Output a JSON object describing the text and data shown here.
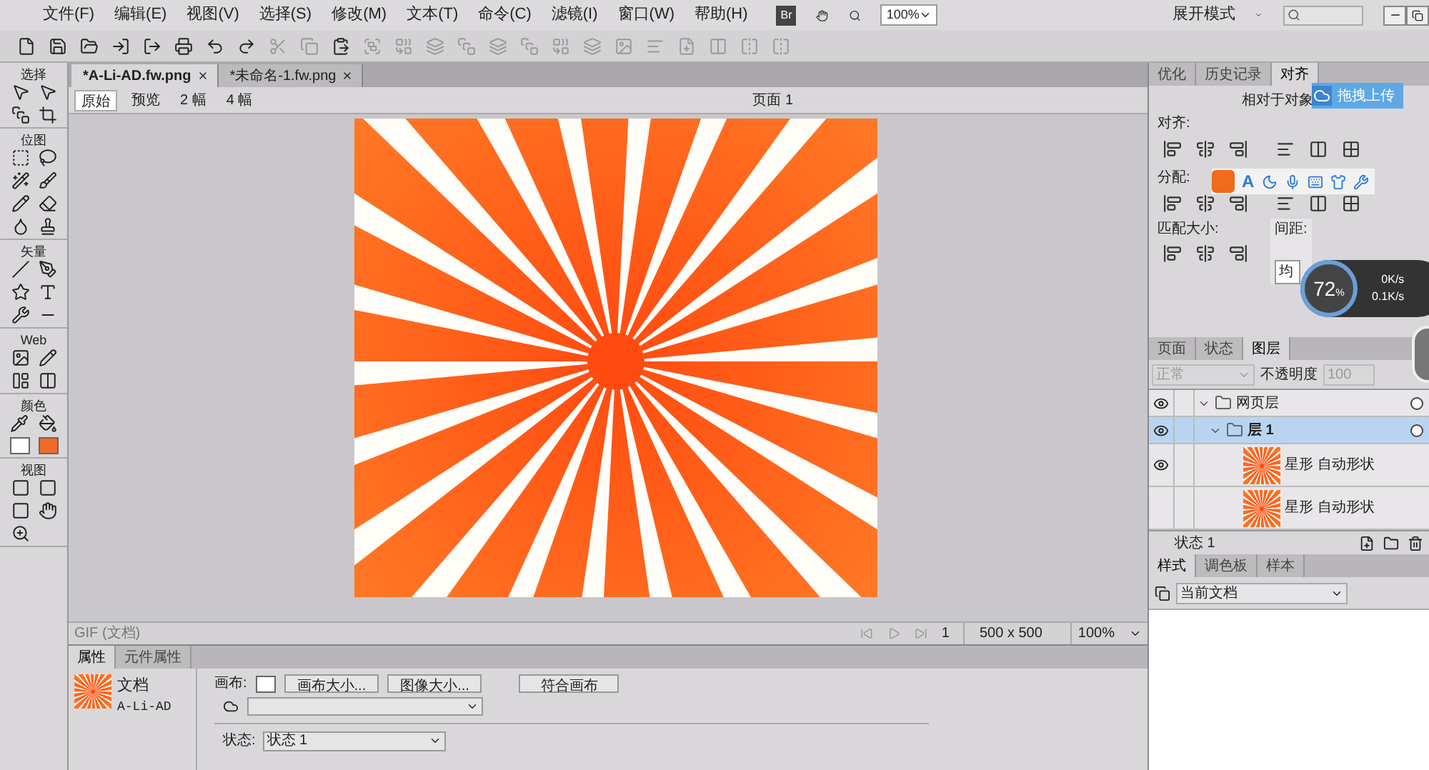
{
  "menu": [
    "文件(F)",
    "编辑(E)",
    "视图(V)",
    "选择(S)",
    "修改(M)",
    "文本(T)",
    "命令(C)",
    "滤镜(I)",
    "窗口(W)",
    "帮助(H)"
  ],
  "app_badge": "Br",
  "zoom": "100%",
  "workspace": "展开模式",
  "doc_tabs": [
    {
      "label": "*A-Li-AD.fw.png",
      "selected": true
    },
    {
      "label": "*未命名-1.fw.png",
      "selected": false
    }
  ],
  "view_modes": [
    {
      "label": "原始",
      "selected": true
    },
    {
      "label": "预览",
      "selected": false
    },
    {
      "label": "2 幅",
      "selected": false
    },
    {
      "label": "4 幅",
      "selected": false
    }
  ],
  "page": "页面 1",
  "tool_sections": [
    "选择",
    "位图",
    "矢量",
    "Web",
    "颜色",
    "视图"
  ],
  "status_bar": {
    "format": "GIF (文档)",
    "frame": "1",
    "size": "500 x 500",
    "zoom": "100%"
  },
  "properties": {
    "tabs": [
      {
        "label": "属性",
        "selected": true
      },
      {
        "label": "元件属性",
        "selected": false
      }
    ],
    "doc_type": "文档",
    "doc_name": "A-Li-AD",
    "canvas_label": "画布:",
    "buttons": [
      "画布大小...",
      "图像大小...",
      "符合画布"
    ],
    "state_label": "状态:",
    "state_value": "状态 1"
  },
  "align_panel": {
    "tabs": [
      {
        "label": "优化",
        "selected": false
      },
      {
        "label": "历史记录",
        "selected": false
      },
      {
        "label": "对齐",
        "selected": true
      }
    ],
    "relative_to": "相对于对象",
    "align": "对齐:",
    "distribute": "分配:",
    "match_size": "匹配大小:",
    "spacing": "间距:",
    "spacing_field": "均"
  },
  "layers_panel": {
    "tabs": [
      {
        "label": "页面",
        "selected": false
      },
      {
        "label": "状态",
        "selected": false
      },
      {
        "label": "图层",
        "selected": true
      }
    ],
    "blend": "正常",
    "opacity_label": "不透明度",
    "opacity": "100",
    "layers": [
      {
        "name": "网页层",
        "kind": "folder",
        "visible": true,
        "selected": false,
        "children": [
          {
            "name": "层 1",
            "kind": "folder",
            "visible": true,
            "selected": true,
            "children": [
              {
                "name": "星形 自动形状",
                "kind": "object",
                "visible": true,
                "selected": false
              },
              {
                "name": "星形 自动形状",
                "kind": "object",
                "visible": false,
                "selected": false
              }
            ]
          }
        ]
      }
    ],
    "state": "状态 1"
  },
  "styles_panel": {
    "tabs": [
      {
        "label": "样式",
        "selected": true
      },
      {
        "label": "调色板",
        "selected": false
      },
      {
        "label": "样本",
        "selected": false
      }
    ],
    "source": "当前文档"
  },
  "overlays": {
    "upload": "拖拽上传",
    "ime_letter": "A",
    "speed_percent": "72",
    "speed_unit": "%",
    "down": "0K/s",
    "up": "0.1K/s"
  }
}
